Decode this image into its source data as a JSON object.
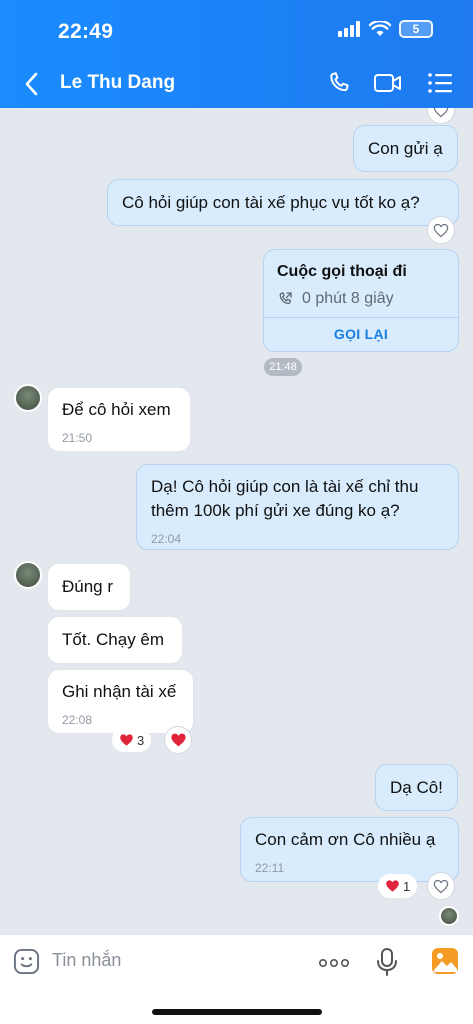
{
  "status_bar": {
    "time": "22:49",
    "battery": "5"
  },
  "header": {
    "contact_name": "Le Thu Dang"
  },
  "messages": {
    "m1": {
      "text": "Con gửi ạ"
    },
    "m2": {
      "text": "Cô hỏi giúp con tài xế phục vụ tốt ko ạ?"
    },
    "call": {
      "title": "Cuộc gọi thoại đi",
      "duration": "0 phút 8 giây",
      "action": "GỌI LẠI"
    },
    "divider_time": "21:48",
    "m3": {
      "text": "Để cô hỏi xem",
      "time": "21:50"
    },
    "m4": {
      "line1": "Dạ! Cô hỏi giúp con là tài xế chỉ thu",
      "line2": "thêm 100k phí gửi xe đúng ko ạ?",
      "time": "22:04"
    },
    "m5": {
      "text": "Đúng r"
    },
    "m6": {
      "text": "Tốt. Chạy êm"
    },
    "m7": {
      "text": "Ghi nhận tài xế",
      "time": "22:08",
      "reaction_count": "3"
    },
    "m8": {
      "text": "Dạ Cô!"
    },
    "m9": {
      "text": "Con cảm ơn Cô nhiều ạ",
      "time": "22:11",
      "reaction_count": "1"
    }
  },
  "input": {
    "placeholder": "Tin nhắn"
  },
  "colors": {
    "header": "#1a8cff",
    "outgoing": "#d8ecfd",
    "incoming": "#ffffff",
    "heart": "#e0243a",
    "accent": "#1a7de0"
  }
}
